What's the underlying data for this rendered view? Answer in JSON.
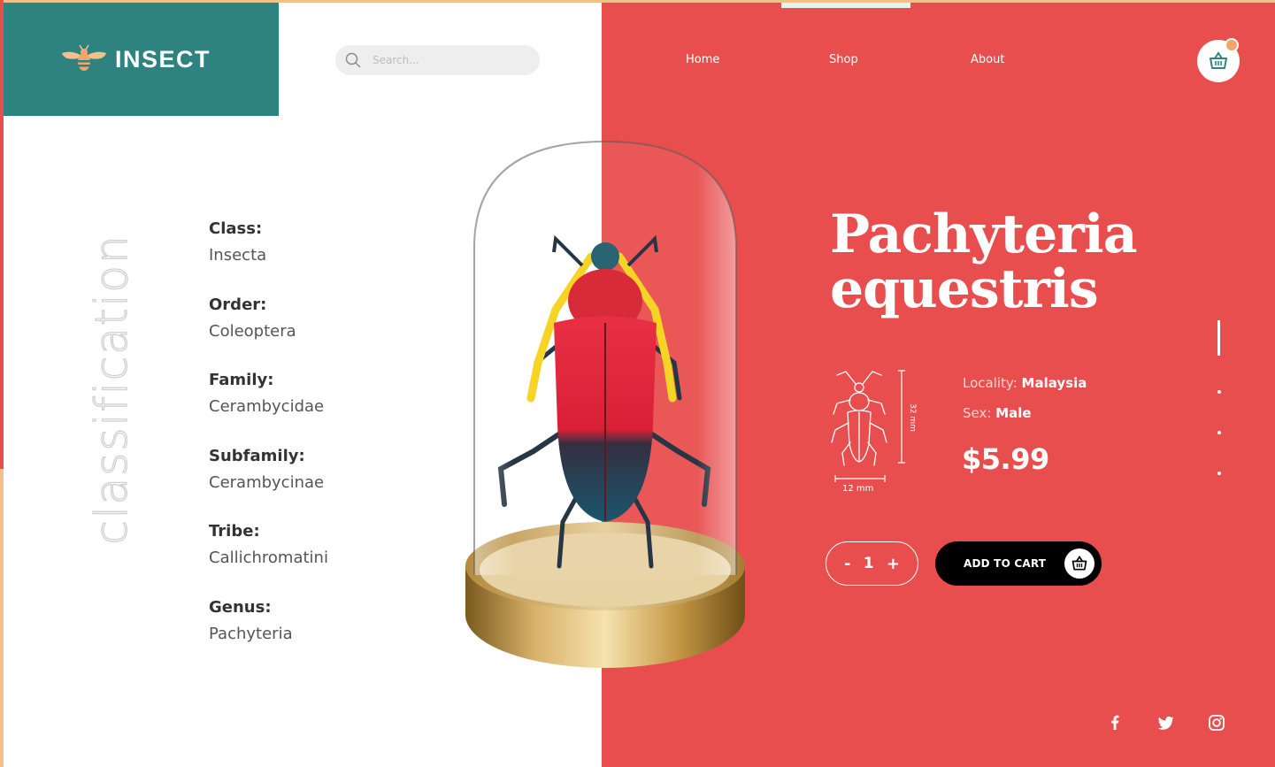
{
  "brand": {
    "name": "INSECT"
  },
  "search": {
    "placeholder": "Search..."
  },
  "nav": {
    "items": [
      "Home",
      "Shop",
      "About"
    ]
  },
  "sidebar": {
    "vertical_label": "classification"
  },
  "classification": [
    {
      "label": "Class:",
      "value": "Insecta"
    },
    {
      "label": "Order:",
      "value": "Coleoptera"
    },
    {
      "label": "Family:",
      "value": "Cerambycidae"
    },
    {
      "label": "Subfamily:",
      "value": "Cerambycinae"
    },
    {
      "label": "Tribe:",
      "value": "Callichromatini"
    },
    {
      "label": "Genus:",
      "value": "Pachyteria"
    }
  ],
  "product": {
    "title_line1": "Pachyteria",
    "title_line2": "equestris",
    "dimension_length": "32 mm",
    "dimension_width": "12 mm",
    "locality_label": "Locality:",
    "locality_value": "Malaysia",
    "sex_label": "Sex:",
    "sex_value": "Male",
    "price": "$5.99",
    "quantity": "1",
    "qty_minus": "-",
    "qty_plus": "+",
    "add_to_cart_label": "ADD TO CART"
  },
  "pager": {
    "active_index": 0,
    "count": 4
  },
  "social": [
    "facebook-icon",
    "twitter-icon",
    "instagram-icon"
  ],
  "colors": {
    "teal": "#2e8380",
    "coral": "#e84e4e",
    "gold": "#f2c08a",
    "black": "#000000",
    "white": "#ffffff"
  }
}
